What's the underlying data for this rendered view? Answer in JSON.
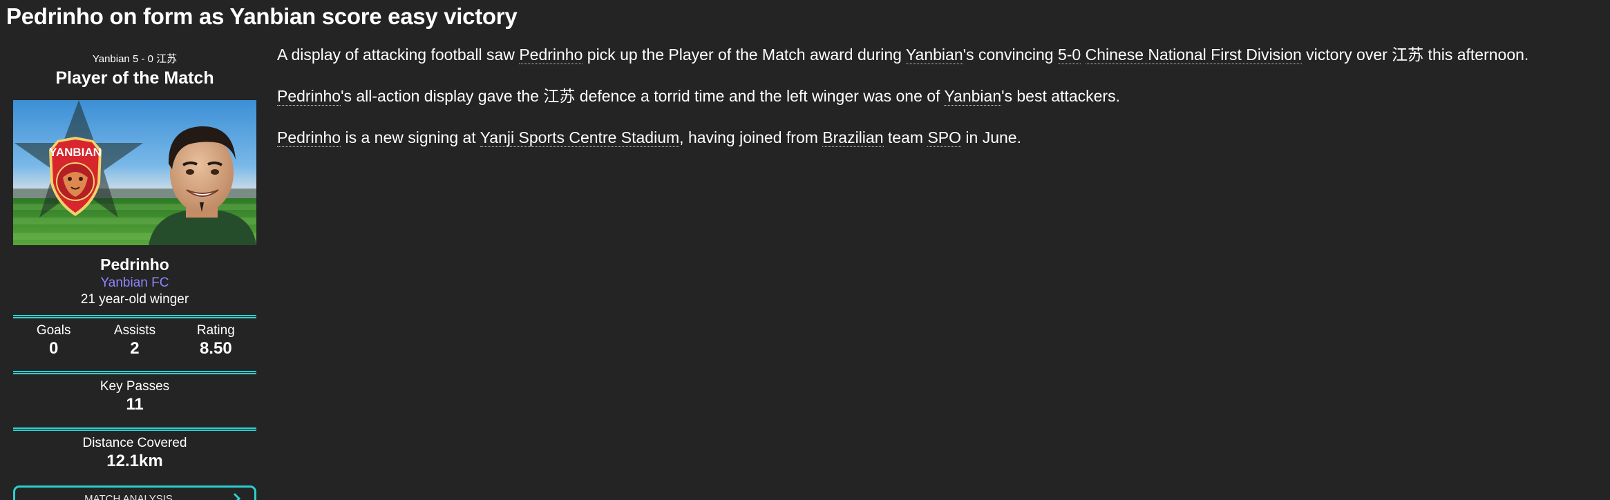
{
  "headline": "Pedrinho on form as Yanbian score easy victory",
  "sidebar": {
    "score_line": "Yanbian 5 - 0 江苏",
    "award_title": "Player of the Match",
    "player_name": "Pedrinho",
    "club": "Yanbian FC",
    "age_position": "21 year-old winger",
    "club_badge_text": "YANBIAN",
    "stats": {
      "goals_label": "Goals",
      "goals_value": "0",
      "assists_label": "Assists",
      "assists_value": "2",
      "rating_label": "Rating",
      "rating_value": "8.50",
      "key_passes_label": "Key Passes",
      "key_passes_value": "11",
      "distance_label": "Distance Covered",
      "distance_value": "12.1km"
    },
    "button_label": "MATCH ANALYSIS"
  },
  "article": {
    "p1": {
      "t1": "A display of attacking football saw ",
      "l1": "Pedrinho",
      "t2": " pick up the Player of the Match award during ",
      "l2": "Yanbian",
      "t3": "'s convincing ",
      "l3": "5-0",
      "t4": " ",
      "l4": "Chinese National First Division",
      "t5": " victory over 江苏 this afternoon."
    },
    "p2": {
      "l1": "Pedrinho",
      "t1": "'s all-action display gave the 江苏 defence a torrid time and the left winger was one of ",
      "l2": "Yanbian",
      "t2": "'s best attackers."
    },
    "p3": {
      "l1": "Pedrinho",
      "t1": " is a new signing at ",
      "l2": "Yanji Sports Centre Stadium",
      "t2": ", having joined from ",
      "l3": "Brazilian",
      "t3": " team ",
      "l4": "SPO",
      "t4": " in June."
    }
  },
  "colors": {
    "background": "#242424",
    "accent": "#2ad1d0",
    "club_link": "#8f86ff",
    "badge_red": "#d7262e"
  },
  "icons": {
    "button_chevron": "chevron-right-icon",
    "badge": "club-badge-icon",
    "player_photo": "player-photo"
  }
}
